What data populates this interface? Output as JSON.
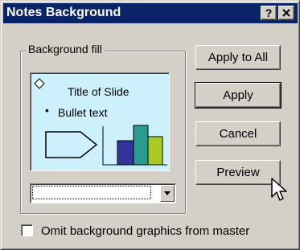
{
  "window": {
    "title": "Notes Background",
    "help_label": "?",
    "close_label": "✕"
  },
  "group": {
    "label": "Background fill"
  },
  "preview": {
    "slide_title": "Title of Slide",
    "bullet": "•",
    "bullet_text": "Bullet text",
    "background_color": "#ccf0fc",
    "shape_fill": "#ccf0fc",
    "bar_colors": [
      "#33339a",
      "#2a9b8f",
      "#a8cc24"
    ]
  },
  "dropdown": {
    "selected_value": ""
  },
  "buttons": {
    "apply_all": "Apply to All",
    "apply": "Apply",
    "cancel": "Cancel",
    "preview": "Preview"
  },
  "checkbox": {
    "label": "Omit background graphics from master",
    "checked": false
  },
  "colors": {
    "titlebar": "#0a246a",
    "face": "#d4d0c8"
  },
  "icons": {
    "cursor": "arrow-cursor-icon"
  }
}
